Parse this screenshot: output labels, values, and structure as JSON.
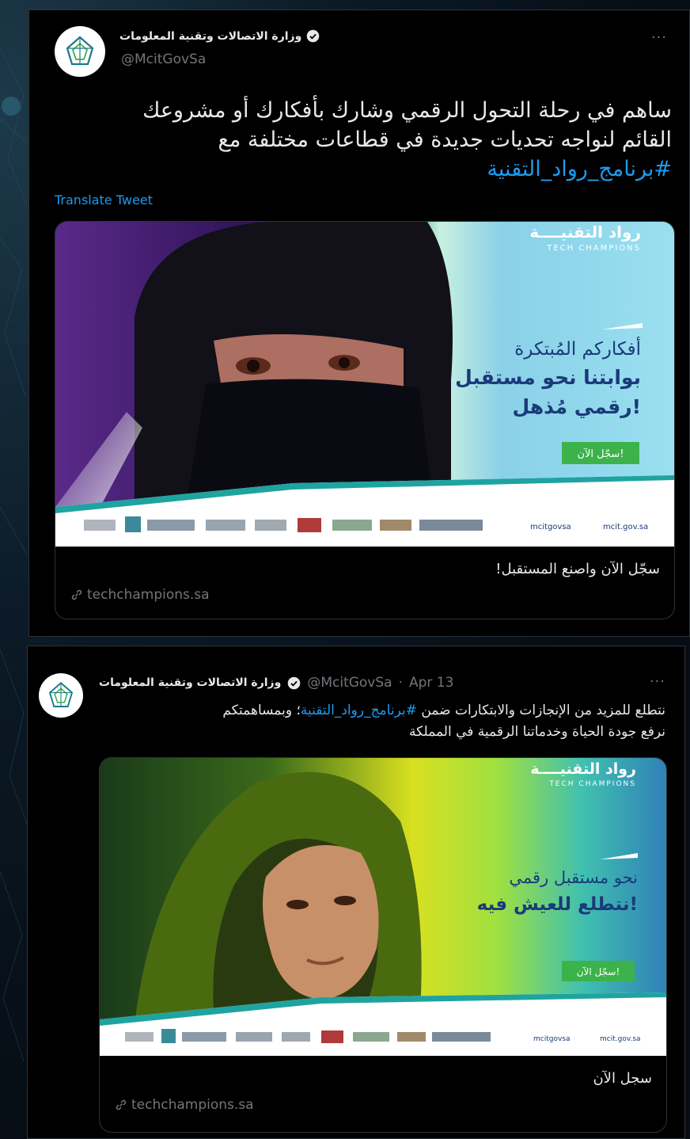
{
  "tweet1": {
    "author_name": "وزارة الاتصالات وتقنية المعلومات",
    "handle": "@McitGovSa",
    "more_label": "···",
    "text_line1": "ساهم في رحلة التحول الرقمي وشارك بأفكارك أو مشروعك",
    "text_line2": "القائم لنواجه تحديات جديدة في قطاعات مختلفة مع",
    "hashtag": "#برنامج_رواد_التقنية",
    "translate_label": "Translate Tweet",
    "card": {
      "brand_ar": "رواد التقنيــــة",
      "brand_en": "TECH CHAMPIONS",
      "headline_1": "أفكاركم المُبتكرة",
      "headline_2": "بوابتنا نحو مستقبل",
      "headline_3": "رقمي مُذهل!",
      "cta": "سجّل الآن!",
      "footer_social": "mcitgovsa",
      "footer_site": "mcit.gov.sa",
      "title": "سجّل الآن واصنع المستقبل!",
      "link": "techchampions.sa"
    }
  },
  "tweet2": {
    "author_name": "وزارة الاتصالات وتقنية المعلومات",
    "handle": "@McitGovSa",
    "date": "Apr 13",
    "more_label": "···",
    "text_part1": "نتطلع للمزيد من الإنجازات والابتكارات ضمن",
    "hashtag": "#برنامج_رواد_التقنية",
    "text_part2": "؛ وبمساهمتكم",
    "text_line2": "نرفع جودة الحياة وخدماتنا الرقمية في المملكة",
    "card": {
      "brand_ar": "رواد التقنيــــة",
      "brand_en": "TECH CHAMPIONS",
      "headline_1": "نحو مستقبل رقمي",
      "headline_2": "نتطلع للعيش فيه!",
      "cta": "سجّل الآن!",
      "footer_social": "mcitgovsa",
      "footer_site": "mcit.gov.sa",
      "title": "سجل الآن",
      "link": "techchampions.sa"
    }
  },
  "colors": {
    "link_blue": "#1d9bf0",
    "promo_navy": "#1b3a7a",
    "promo_green": "#3cb24a",
    "muted": "#71767b"
  }
}
